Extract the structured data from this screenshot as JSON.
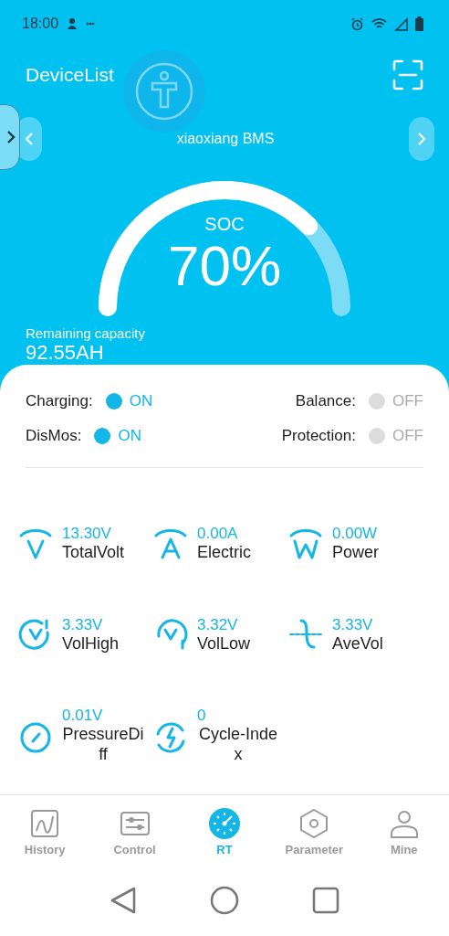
{
  "status_bar": {
    "time": "18:00"
  },
  "header": {
    "title": "DeviceList"
  },
  "device": {
    "name": "xiaoxiang BMS"
  },
  "gauge": {
    "label": "SOC",
    "value": "70%"
  },
  "remaining": {
    "label": "Remaining capacity",
    "value": "92.55AH"
  },
  "switches": [
    {
      "label": "Charging:",
      "on": true,
      "text": "ON"
    },
    {
      "label": "Balance:",
      "on": false,
      "text": "OFF"
    },
    {
      "label": "DisMos:",
      "on": true,
      "text": "ON"
    },
    {
      "label": "Protection:",
      "on": false,
      "text": "OFF"
    }
  ],
  "metrics": [
    {
      "kind": "volt",
      "value": "13.30V",
      "label": "TotalVolt"
    },
    {
      "kind": "amp",
      "value": "0.00A",
      "label": "Electric"
    },
    {
      "kind": "watt",
      "value": "0.00W",
      "label": "Power"
    },
    {
      "kind": "high",
      "value": "3.33V",
      "label": "VolHigh"
    },
    {
      "kind": "low",
      "value": "3.32V",
      "label": "VolLow"
    },
    {
      "kind": "ave",
      "value": "3.33V",
      "label": "AveVol"
    },
    {
      "kind": "diff",
      "value": "0.01V",
      "label": "PressureDiff"
    },
    {
      "kind": "cycle",
      "value": "0",
      "label": "Cycle-Index"
    }
  ],
  "tabs": [
    {
      "kind": "history",
      "label": "History",
      "selected": false
    },
    {
      "kind": "control",
      "label": "Control",
      "selected": false
    },
    {
      "kind": "rt",
      "label": "RT",
      "selected": true
    },
    {
      "kind": "parameter",
      "label": "Parameter",
      "selected": false
    },
    {
      "kind": "mine",
      "label": "Mine",
      "selected": false
    }
  ]
}
